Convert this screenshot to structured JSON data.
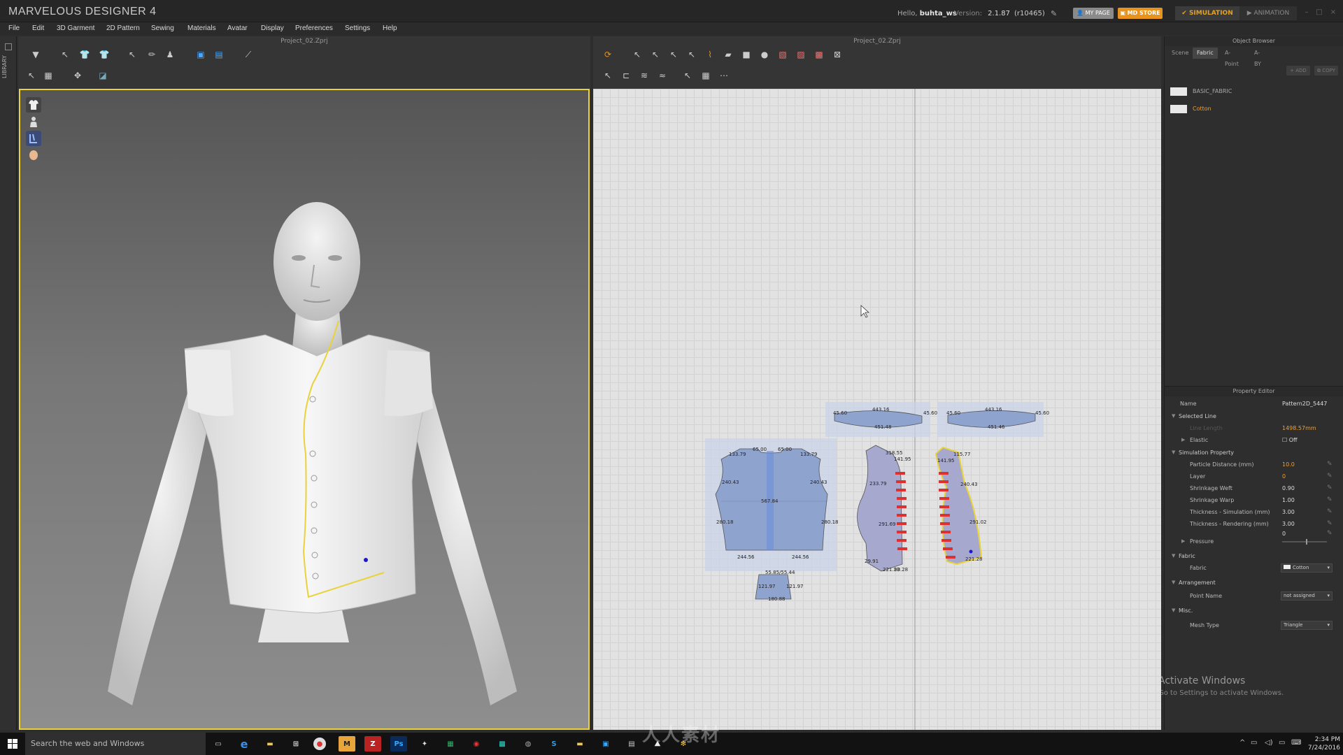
{
  "window": {
    "app_title": "MARVELOUS DESIGNER 4",
    "hello_prefix": "Hello,",
    "user": "buhta_ws",
    "version_label": "Version:",
    "version": "2.1.87",
    "build": "(r10465)",
    "my_page": "MY PAGE",
    "md_store": "MD STORE",
    "mode_simulation": "SIMULATION",
    "mode_animation": "ANIMATION"
  },
  "menu": [
    "File",
    "Edit",
    "3D Garment",
    "2D Pattern",
    "Sewing",
    "Materials",
    "Avatar",
    "Display",
    "Preferences",
    "Settings",
    "Help"
  ],
  "library_label": "LIBRARY",
  "panel3d": {
    "title": "Project_02.Zprj"
  },
  "panel2d": {
    "title": "Project_02.Zprj",
    "labels": {
      "collar_a_top": "443.16",
      "collar_a_left": "45.60",
      "collar_a_right": "45.60",
      "collar_a_bottom": "451.48",
      "collar_b_top": "443.16",
      "collar_b_left": "45.60",
      "collar_b_right": "45.60",
      "collar_b_bottom": "451.46",
      "back_tl": "133.79",
      "back_t1": "65.00",
      "back_t2": "65.00",
      "back_tr": "133.79",
      "back_ml": "240.43",
      "back_mr": "240.43",
      "back_c": "567.84",
      "back_ll": "280.18",
      "back_lr": "280.18",
      "back_bl": "244.56",
      "back_br": "244.56",
      "tab_top": "55.85/55.44",
      "tab_l": "121.97",
      "tab_r": "121.97",
      "tab_b": "180.88",
      "fl_top": "141.95",
      "fl_t2": "318.55",
      "fl_ml": "233.79",
      "fl_red": "291.69",
      "fl_bl": "29.91",
      "fl_bm": "221.23",
      "fl_br": "90.28",
      "fr_top": "115.77",
      "fr_t2": "141.95",
      "fr_mr": "240.43",
      "fr_r2": "291.02",
      "fr_b": "221.28"
    }
  },
  "object_browser": {
    "title": "Object Browser",
    "tabs": [
      "Scene",
      "Fabric",
      "A-Point",
      "A-BY"
    ],
    "active_tab": "Fabric",
    "add": "ADD",
    "copy": "COPY",
    "fabrics": [
      "BASIC_FABRIC",
      "Cotton"
    ],
    "selected_fabric": "Cotton"
  },
  "property_editor": {
    "title": "Property Editor",
    "name_label": "Name",
    "name_value": "Pattern2D_5447",
    "selected_line": "Selected Line",
    "line_length_label": "Line Length",
    "line_length_value": "1498.57mm",
    "elastic_label": "Elastic",
    "elastic_value": "Off",
    "sim_property": "Simulation Property",
    "particle_distance_label": "Particle Distance (mm)",
    "particle_distance_value": "10.0",
    "layer_label": "Layer",
    "layer_value": "0",
    "shrinkage_weft_label": "Shrinkage Weft",
    "shrinkage_weft_value": "0.90",
    "shrinkage_warp_label": "Shrinkage Warp",
    "shrinkage_warp_value": "1.00",
    "thick_sim_label": "Thickness - Simulation (mm)",
    "thick_sim_value": "3.00",
    "thick_render_label": "Thickness - Rendering (mm)",
    "thick_render_value": "3.00",
    "pressure_label": "Pressure",
    "pressure_value": "0",
    "fabric_section": "Fabric",
    "fabric_label": "Fabric",
    "fabric_value": "Cotton",
    "arrangement": "Arrangement",
    "point_name_label": "Point Name",
    "point_name_value": "not assigned",
    "misc": "Misc.",
    "mesh_type_label": "Mesh Type",
    "mesh_type_value": "Triangle"
  },
  "activate": {
    "line1": "Activate Windows",
    "line2": "Go to Settings to activate Windows."
  },
  "taskbar": {
    "search_placeholder": "Search the web and Windows",
    "time": "2:34 PM",
    "date": "7/24/2016"
  },
  "watermark": "人人素材",
  "colors": {
    "accent_orange": "#e7931e",
    "selection_yellow": "#e9d23a",
    "pattern_blue": "#8fa3cf",
    "pattern_fill": "#9aa6cc"
  }
}
